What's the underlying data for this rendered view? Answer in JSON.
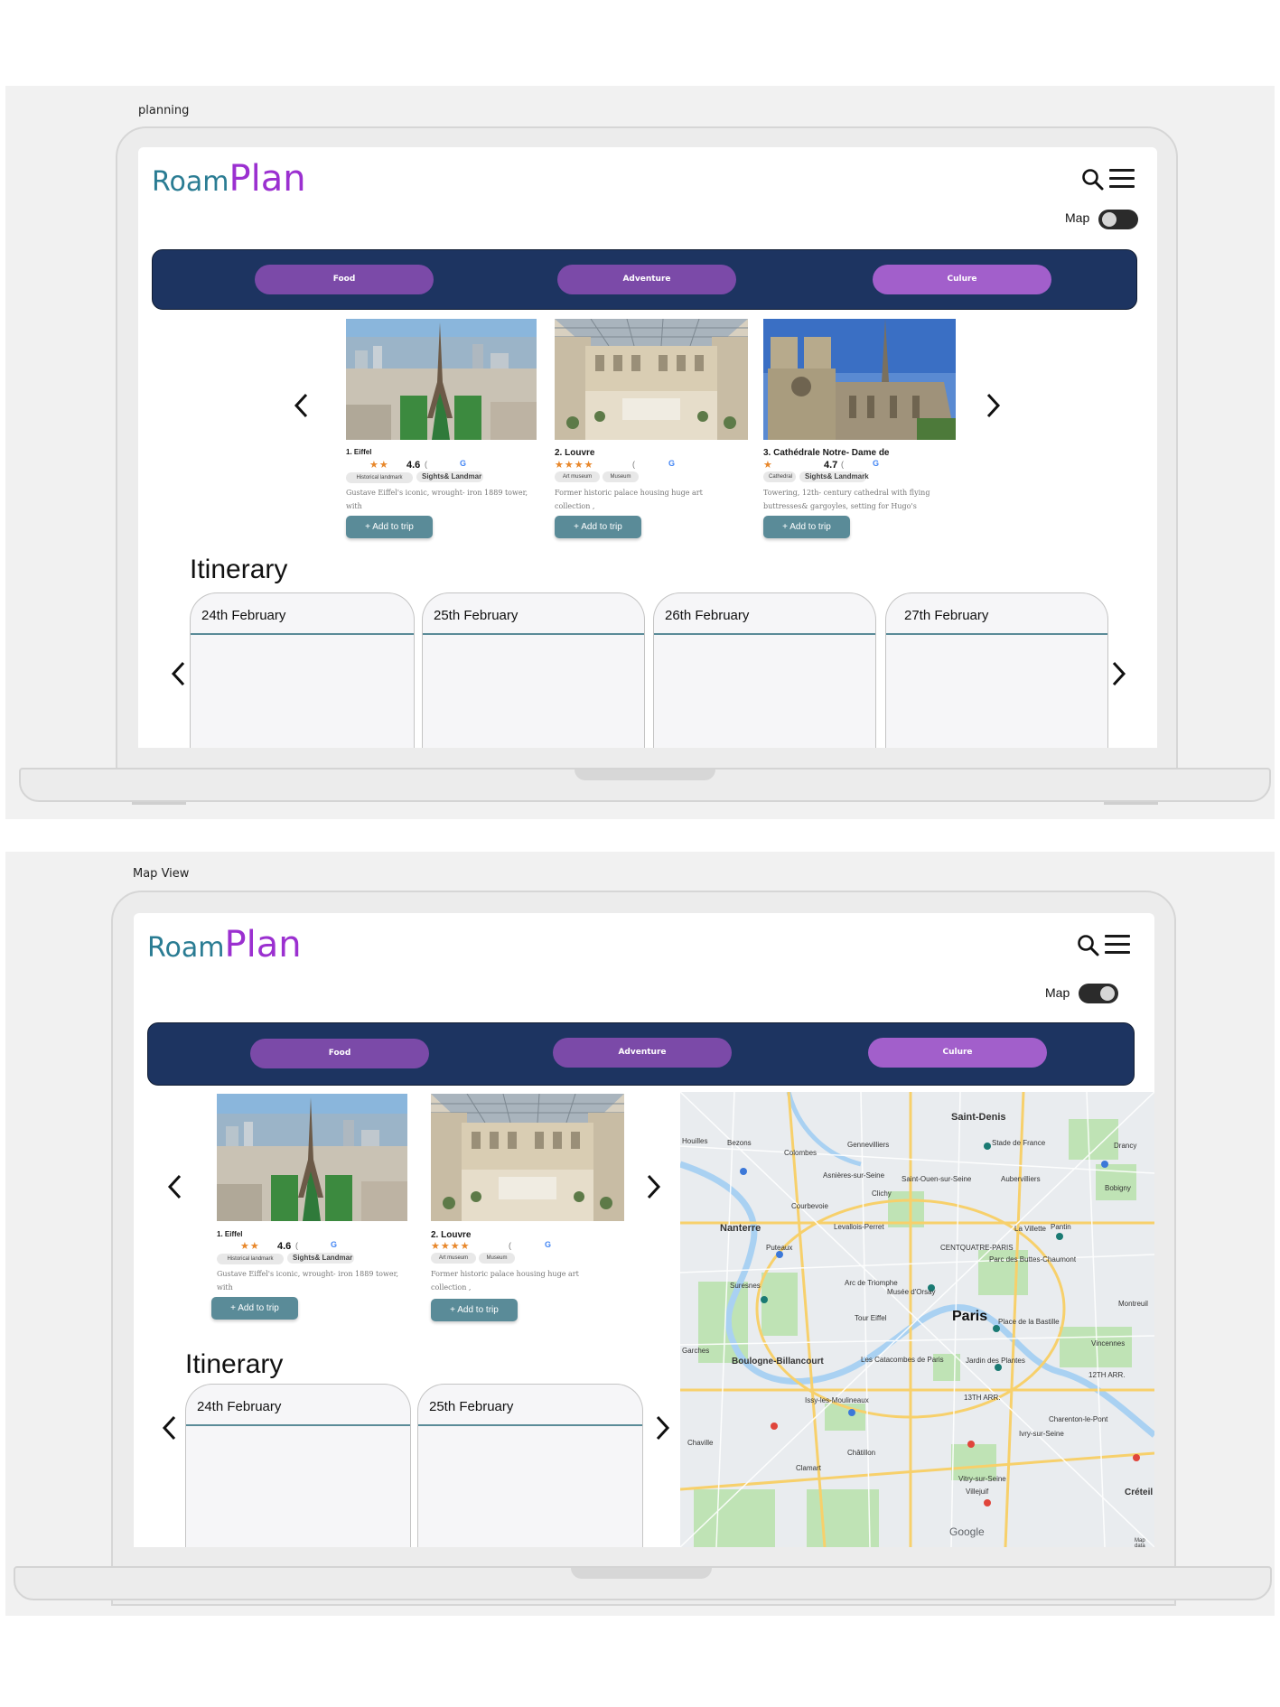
{
  "frames": [
    {
      "label": "planning"
    },
    {
      "label": "Map View"
    }
  ],
  "app": {
    "logo_roam": "Roam",
    "logo_plan": "Plan",
    "map_toggle_label": "Map"
  },
  "categories": {
    "food": "Food",
    "adventure": "Adventure",
    "culture": "Culure"
  },
  "places": [
    {
      "title": "1. Eiffel",
      "rating": "4.6",
      "rating_paren": "(",
      "stars": "★★",
      "tags": [
        "Historical landmark",
        "Sights& Landmar"
      ],
      "description": "Gustave Eiffel's iconic, wrought- iron 1889 tower, with",
      "add_label": "+ Add to trip"
    },
    {
      "title": "2. Louvre",
      "rating": "",
      "rating_paren": "(",
      "stars": "★★★★",
      "tags": [
        "Art museum",
        "Museum"
      ],
      "description": "Former historic palace housing huge art collection ,",
      "add_label": "+ Add to trip"
    },
    {
      "title": "3. Cathédrale Notre- Dame de",
      "rating": "4.7",
      "rating_paren": "(",
      "stars": "★",
      "tags": [
        "Cathedral",
        "Sights& Landmark"
      ],
      "description": "Towering, 12th- century cathedral with flying buttresses& gargoyles, setting for Hugo's",
      "add_label": "+ Add to trip"
    }
  ],
  "itinerary": {
    "title": "Itinerary",
    "days": [
      "24th February",
      "25th February",
      "26th February",
      "27th February"
    ]
  },
  "map": {
    "labels": [
      "Saint-Denis",
      "Paris",
      "Nanterre",
      "Puteaux",
      "Colombes",
      "Gennevilliers",
      "Aubervilliers",
      "Pantin",
      "Bobigny",
      "Drancy",
      "Courbevoie",
      "Levallois-Perret",
      "Asnières-sur-Seine",
      "Saint-Ouen-sur-Seine",
      "Clichy",
      "Arc de Triomphe",
      "Tour Eiffel",
      "Suresnes",
      "Boulogne-Billancourt",
      "Issy-les-Moulineaux",
      "Vincennes",
      "Montreuil",
      "Châtillon",
      "Clamart",
      "Chaville",
      "Garches",
      "Houilles",
      "Bezons",
      "Charenton-le-Pont",
      "Ivry-sur-Seine",
      "Vitry-sur-Seine",
      "Villejuif",
      "Créteil",
      "13TH ARR.",
      "12TH ARR.",
      "Les Catacombes de Paris",
      "Jardin des Plantes",
      "Place de la Bastille",
      "Stade de France",
      "CENTQUATRE-PARIS",
      "Musée d'Orsay",
      "La Villette",
      "Parc des Buttes-Chaumont",
      "Google",
      "Map data"
    ],
    "brand": "Google"
  },
  "colors": {
    "navy": "#1d3461",
    "pill": "#7b4aa8",
    "pill_active": "#a25fcb",
    "teal": "#5a8b98",
    "roam": "#2a7c93",
    "plan": "#9b30d0"
  }
}
